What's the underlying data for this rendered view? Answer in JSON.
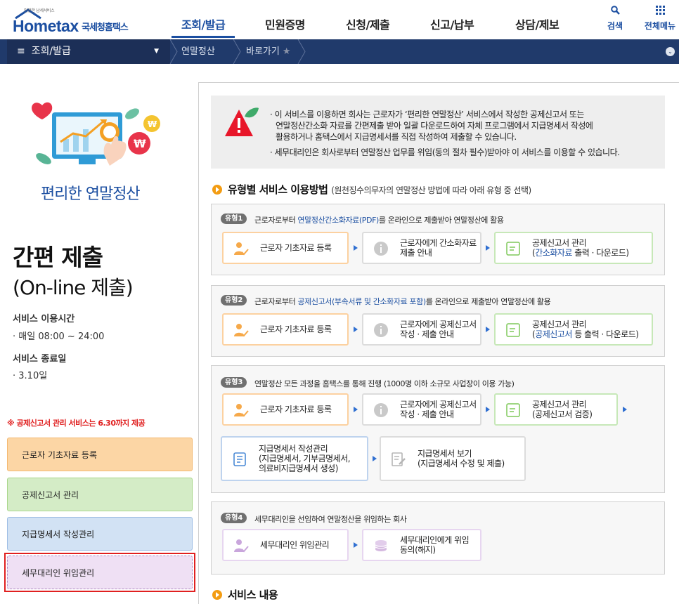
{
  "header": {
    "logo_small": "안전한 납세서비스",
    "logo_main": "Hometax",
    "logo_kor": "국세청홈택스",
    "gnb": [
      "조회/발급",
      "민원증명",
      "신청/제출",
      "신고/납부",
      "상담/제보"
    ],
    "search_label": "검색",
    "menu_label": "전체메뉴"
  },
  "subbar": {
    "title": "조회/발급",
    "crumb1": "연말정산",
    "crumb2": "바로가기"
  },
  "left": {
    "service_title": "편리한 연말정산",
    "big1": "간편 제출",
    "big2": "(On-line 제출)",
    "time_label": "서비스 이용시간",
    "time_value": "· 매일 08:00 ~ 24:00",
    "end_label": "서비스 종료일",
    "end_value": "· 3.10일",
    "notice": "※ 공제신고서 관리 서비스는 6.30까지 제공",
    "buttons": [
      "근로자 기초자료 등록",
      "공제신고서 관리",
      "지급명세서 작성관리",
      "세무대리인 위임관리"
    ]
  },
  "info": {
    "line1": "· 이 서비스를 이용하면 회사는 근로자가  ‘편리한 연말정산’  서비스에서 작성한 공제신고서 또는",
    "line2": "연말정산간소화  자료를 간편제출 받아 일괄 다운로드하여 자체 프로그램에서 지급명세서 작성에",
    "line3": "활용하거나 홈택스에서 지급명세서를 직접 작성하여 제출할 수 있습니다.",
    "line4": "· 세무대리인은 회사로부터 연말정산 업무를 위임(동의 절차 필수)받아야 이 서비스를 이용할 수 있습니다."
  },
  "section1": {
    "title": "유형별 서비스 이용방법",
    "sub": "(원천징수의무자의 연말정산 방법에 따라 아래 유형 중 선택)"
  },
  "types": [
    {
      "badge": "유형1",
      "pre": "근로자로부터 ",
      "hl": "연말정산간소화자료(PDF)",
      "post": "를 온라인으로 제출받아 연말정산에 활용",
      "s1": "근로자 기초자료 등록",
      "s2a": "근로자에게 간소화자료",
      "s2b": "제출 안내",
      "s3a": "공제신고서 관리",
      "s3b_hl": "간소화자료",
      "s3b_post": " 출력 · 다운로드)"
    },
    {
      "badge": "유형2",
      "pre": "근로자로부터 ",
      "hl": "공제신고서(부속서류 및 간소화자료 포함)",
      "post": "를 온라인으로 제출받아 연말정산에 활용",
      "s1": "근로자 기초자료 등록",
      "s2a": "근로자에게 공제신고서",
      "s2b": "작성 · 제출 안내",
      "s3a": "공제신고서 관리",
      "s3b_hl": "공제신고서",
      "s3b_post": " 등 출력 · 다운로드)"
    },
    {
      "badge": "유형3",
      "text": "연말정산 모든 과정을 홈택스를 통해 진행 (1000명 이하 소규모 사업장이 이용 가능)",
      "s1": "근로자 기초자료 등록",
      "s2a": "근로자에게 공제신고서",
      "s2b": "작성 · 제출 안내",
      "s3a": "공제신고서 관리",
      "s3b": "(공제신고서 검증)",
      "s4a": "지급명세서 작성관리",
      "s4b": "(지급명세서, 기부금명세서,",
      "s4c": "의료비지급명세서 생성)",
      "s5a": "지급명세서 보기",
      "s5b": "(지급명세서 수정 및 제출)"
    },
    {
      "badge": "유형4",
      "text": "세무대리인을 선임하여 연말정산을 위임하는 회사",
      "s1": "세무대리인 위임관리",
      "s2a": "세무대리인에게 위임",
      "s2b": "동의(해지)"
    }
  ],
  "section2": {
    "title": "서비스 내용"
  },
  "colors": {
    "brand": "#1c4fa1",
    "subbar": "#203a6b",
    "accent": "#f39c12",
    "alert": "#e02020"
  }
}
